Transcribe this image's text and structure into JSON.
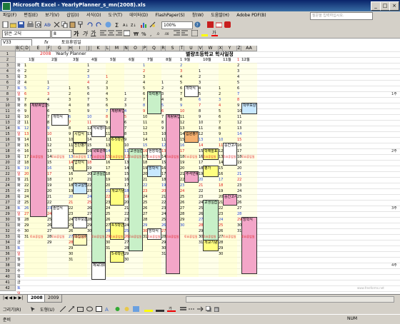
{
  "window": {
    "title": "Microsoft Excel - YearlyPlanner_s_mn(2008).xls"
  },
  "menu": {
    "items": [
      "파일(F)",
      "편집(E)",
      "보기(V)",
      "삽입(I)",
      "서식(O)",
      "도구(T)",
      "데이터(D)",
      "FlashPaper(S)",
      "창(W)",
      "도움말(H)",
      "Adobe PDF(B)"
    ],
    "help_placeholder": "질문을 입력하십시오."
  },
  "toolbar": {
    "zoom": "100%",
    "font_name": "맑은 고딕",
    "font_size": "8"
  },
  "formula_bar": {
    "name_box": "V33",
    "fx": "fx",
    "value": "토요휴업일"
  },
  "sheet": {
    "columns": [
      "B",
      "C",
      "D",
      "E",
      "F",
      "G",
      "H",
      "I",
      "J",
      "K",
      "L",
      "M",
      "N",
      "O",
      "P",
      "Q",
      "R",
      "S",
      "T",
      "U",
      "V",
      "W",
      "X",
      "Y",
      "Z",
      "AA"
    ],
    "year": "2008",
    "planner_label": "Yearly Planner",
    "title": "별량초등학교 학사일정",
    "months": [
      "1월",
      "2월",
      "3월",
      "4월",
      "5월",
      "6월",
      "7월",
      "8월",
      "9월",
      "10월",
      "11월",
      "12월"
    ],
    "weekdays": [
      "화",
      "수",
      "목",
      "금",
      "토",
      "일",
      "월",
      "화",
      "수",
      "목",
      "금",
      "토",
      "일",
      "월",
      "화",
      "수",
      "목",
      "금",
      "토",
      "일",
      "월",
      "화",
      "수",
      "목",
      "금",
      "토",
      "일",
      "월",
      "화",
      "수",
      "목",
      "금",
      "토",
      "일",
      "월",
      "화",
      "수",
      "목",
      "금",
      "토",
      "일"
    ],
    "side_labels": [
      "1주",
      "2주",
      "3주",
      "4주",
      "5주"
    ],
    "watermark": "www.freeforms.net",
    "saturday_label": "토요휴업일",
    "events": {
      "e1": "개학식",
      "e2": "졸업식",
      "e3": "종업식",
      "e4": "시업식",
      "e5": "중간고사",
      "e6": "진단평가",
      "e7": "입학식",
      "e8": "학부모총회",
      "e9": "학교설명회",
      "e10": "식목행사",
      "e11": "국토순례",
      "e12": "교생실습",
      "e13": "과학의날",
      "e14": "학력평가",
      "e15": "현장학습",
      "e16": "교생실습",
      "e17": "체육대회",
      "e18": "개교기념일",
      "e19": "재량휴업일",
      "e20": "6-5학년",
      "e21": "4-5학년",
      "e22": "학업성취도평가",
      "e23": "기말고사",
      "e24": "방학식",
      "e25": "개학식",
      "e26": "방학식",
      "e27": "학부모상담",
      "e28": "재량휴업일",
      "e29": "추석연휴",
      "e30": "입원평가",
      "e31": "교생실습",
      "e32": "중간평가",
      "e33": "개교기념일",
      "e34": "학예발표회",
      "e35": "재량휴업일",
      "e36": "중간고사",
      "e37": "기말고사",
      "e38": "방학식",
      "e39": "중간고사",
      "e40": "5-6학년",
      "e41": "평가",
      "e42": "의무교육",
      "e43": "3학년",
      "e44": "6학년"
    }
  },
  "tabs": [
    "2008",
    "2009"
  ],
  "drawbar": {
    "label": "그리기(R)",
    "shapes": "도형(U)"
  },
  "status": {
    "left": "준비",
    "right": "NUM"
  }
}
